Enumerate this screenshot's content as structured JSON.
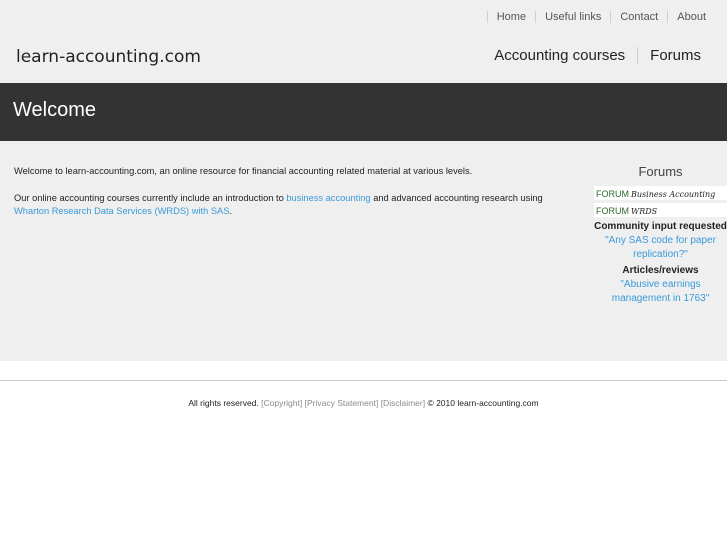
{
  "header": {
    "logo": "learn-accounting.com",
    "top_nav": [
      "Home",
      "Useful links",
      "Contact",
      "About"
    ],
    "main_nav": [
      "Accounting courses",
      "Forums"
    ]
  },
  "banner": {
    "title": "Welcome"
  },
  "main": {
    "intro": "Welcome to learn-accounting.com, an online resource for financial accounting related material at various levels.",
    "courses_prefix": "Our online accounting courses currently include an introduction to ",
    "courses_link1": "business accounting",
    "courses_middle": " and advanced accounting research using ",
    "courses_link2": "Wharton Research Data Services (WRDS) with SAS",
    "courses_suffix": "."
  },
  "sidebar": {
    "title": "Forums",
    "forums": [
      {
        "tag": "FORUM",
        "name": "Business Accounting"
      },
      {
        "tag": "FORUM",
        "name": "WRDS"
      }
    ],
    "community_heading": "Community input requested",
    "community_link": "\"Any SAS code for paper replication?\"",
    "articles_heading": "Articles/reviews",
    "articles_link": "\"Abusive earnings management in 1763\""
  },
  "footer": {
    "prefix": "All rights reserved. ",
    "links": [
      "[Copyright]",
      "[Privacy Statement]",
      "[Disclaimer]"
    ],
    "suffix": " © 2010 learn-accounting.com"
  },
  "colors": {
    "link": "#3a9ad9",
    "banner_bg": "#333333",
    "page_bg": "#efefef",
    "forum_tag": "#2e6b2e"
  }
}
